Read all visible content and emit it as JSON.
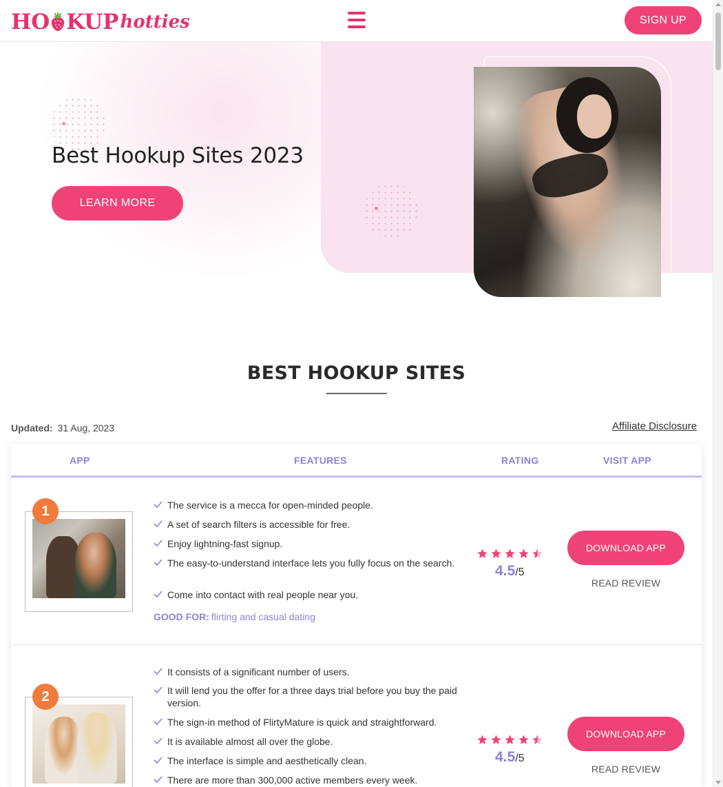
{
  "header": {
    "logo_part1": "HO",
    "logo_part2": "KUP",
    "logo_script": "hotties",
    "menu_icon": "hamburger-icon",
    "signup_label": "SIGN UP"
  },
  "colors": {
    "accent": "#ef4377",
    "rank": "#f07b3b",
    "purple": "#8e82d6",
    "hero_panel": "#f9e3ee"
  },
  "hero": {
    "title": "Best Hookup Sites 2023",
    "cta_label": "LEARN MORE"
  },
  "section": {
    "title": "BEST HOOKUP SITES",
    "updated_label": "Updated:",
    "updated_date": "31 Aug, 2023",
    "affiliate_label": "Affiliate Disclosure"
  },
  "table": {
    "headers": [
      "APP",
      "FEATURES",
      "RATING",
      "VISIT APP"
    ],
    "rows": [
      {
        "rank": "1",
        "features": [
          "The service is a mecca for open-minded people.",
          "A set of search filters is accessible for free.",
          "Enjoy lightning-fast signup.",
          "The easy-to-understand interface lets you fully focus on the search.",
          "Come into contact with real people near you."
        ],
        "good_for_label": "GOOD FOR:",
        "good_for": "flirting and casual dating",
        "stars": 4.5,
        "rating": "4.5",
        "rating_max": "/5",
        "download_label": "DOWNLOAD APP",
        "review_label": "READ REVIEW"
      },
      {
        "rank": "2",
        "features": [
          "It consists of a significant number of users.",
          "It will lend you the offer for a three days trial before you buy the paid version.",
          "The sign-in method of FlirtyMature is quick and straightforward.",
          "It is available almost all over the globe.",
          "The interface is simple and aesthetically clean.",
          "There are more than 300,000 active members every week."
        ],
        "stars": 4.5,
        "rating": "4.5",
        "rating_max": "/5",
        "download_label": "DOWNLOAD APP",
        "review_label": "READ REVIEW"
      }
    ]
  }
}
